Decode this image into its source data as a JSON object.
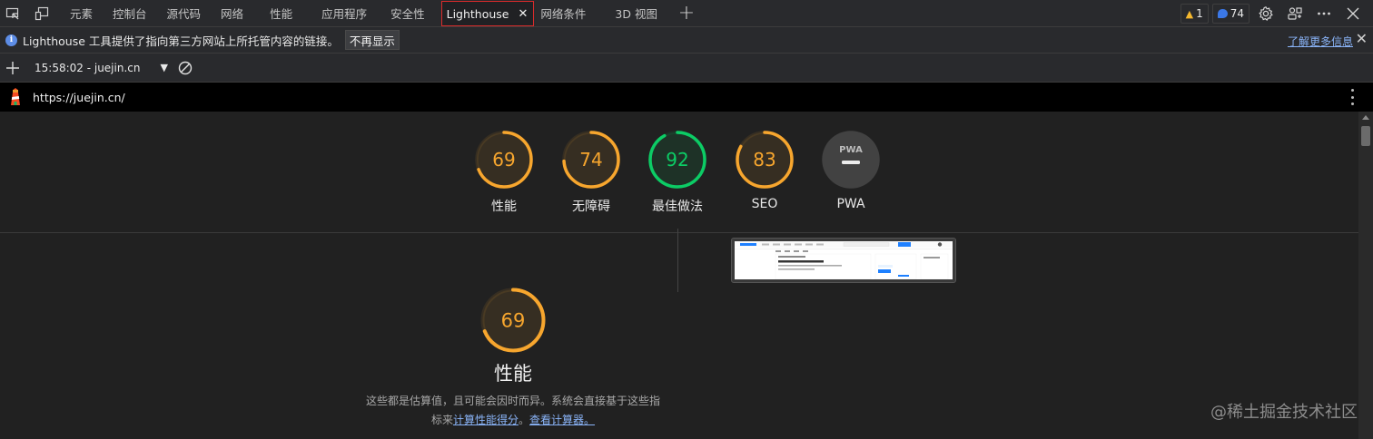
{
  "tabbar": {
    "tabs": [
      {
        "label": "元素"
      },
      {
        "label": "控制台"
      },
      {
        "label": "源代码"
      },
      {
        "label": "网络"
      },
      {
        "label": "性能"
      },
      {
        "label": "应用程序"
      },
      {
        "label": "安全性"
      },
      {
        "label": "Lighthouse",
        "active": true
      },
      {
        "label": "网络条件"
      },
      {
        "label": "3D 视图"
      }
    ],
    "close_glyph": "✕",
    "add_glyph": "+",
    "warnings_count": "1",
    "messages_count": "74",
    "icons": [
      "inspect-icon",
      "device-toolbar-icon",
      "settings-icon",
      "customize-icon",
      "more-icon",
      "close-icon"
    ]
  },
  "infobar": {
    "text": "Lighthouse 工具提供了指向第三方网站上所托管内容的链接。",
    "dismiss_label": "不再显示",
    "learn_more": "了解更多信息",
    "close_glyph": "✕"
  },
  "toolbar": {
    "report_label": "15:58:02 - juejin.cn",
    "dropdown_glyph": "▼"
  },
  "urlbar": {
    "url": "https://juejin.cn/"
  },
  "scores": [
    {
      "value": "69",
      "label": "性能",
      "color": "#f7a62e",
      "fraction": 0.69
    },
    {
      "value": "74",
      "label": "无障碍",
      "color": "#f7a62e",
      "fraction": 0.74
    },
    {
      "value": "92",
      "label": "最佳做法",
      "color": "#0ccc65",
      "fraction": 0.92
    },
    {
      "value": "83",
      "label": "SEO",
      "color": "#f7a62e",
      "fraction": 0.83
    },
    {
      "value": "PWA",
      "label": "PWA",
      "color": "#888888",
      "fraction": 0
    }
  ],
  "performance": {
    "score": "69",
    "fraction": 0.69,
    "color": "#f7a62e",
    "title": "性能",
    "desc_line1": "这些都是估算值，且可能会因时而异。系统会直接基于这些指",
    "desc_prefix": "标来",
    "calc_link": "计算性能得分",
    "sep": "。",
    "calculator_link": "查看计算器。"
  },
  "watermark": "@稀土掘金技术社区"
}
